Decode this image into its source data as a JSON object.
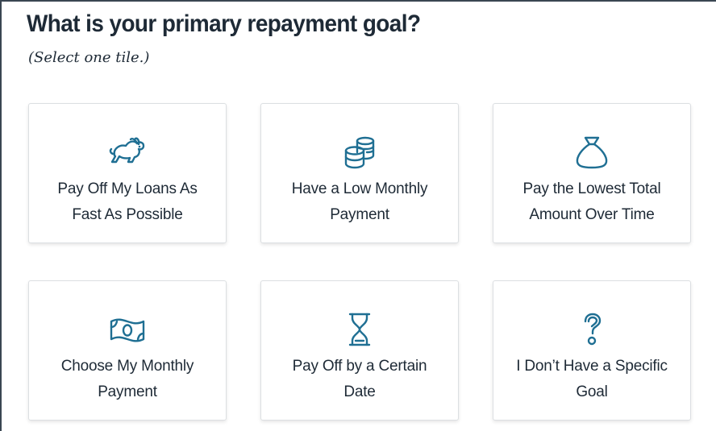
{
  "question": {
    "title": "What is your primary repayment goal?",
    "instruction": "(Select one tile.)"
  },
  "colors": {
    "icon": "#1f6f93",
    "text": "#1e2a36",
    "tile_border": "#dcdfe2"
  },
  "tiles": [
    {
      "icon": "rabbit-icon",
      "label": "Pay Off My Loans As Fast As Possible"
    },
    {
      "icon": "coins-icon",
      "label": "Have a Low Monthly Payment"
    },
    {
      "icon": "money-bag-icon",
      "label": "Pay the Lowest Total Amount Over Time"
    },
    {
      "icon": "banknote-icon",
      "label": "Choose My Monthly Payment"
    },
    {
      "icon": "hourglass-icon",
      "label": "Pay Off by a Certain Date"
    },
    {
      "icon": "question-mark-icon",
      "label": "I Don’t Have a Specific Goal"
    }
  ]
}
